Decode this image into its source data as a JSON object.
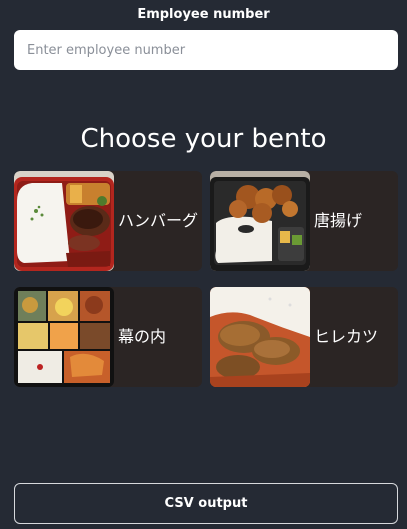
{
  "employee": {
    "label": "Employee number",
    "placeholder": "Enter employee number",
    "value": ""
  },
  "title": "Choose your bento",
  "bentos": [
    {
      "name": "ハンバーグ",
      "icon": "hamburg-steak-bento-photo"
    },
    {
      "name": "唐揚げ",
      "icon": "karaage-bento-photo"
    },
    {
      "name": "幕の内",
      "icon": "makunouchi-bento-photo"
    },
    {
      "name": "ヒレカツ",
      "icon": "hire-katsu-bento-photo"
    }
  ],
  "csv_button": {
    "label": "CSV output"
  }
}
